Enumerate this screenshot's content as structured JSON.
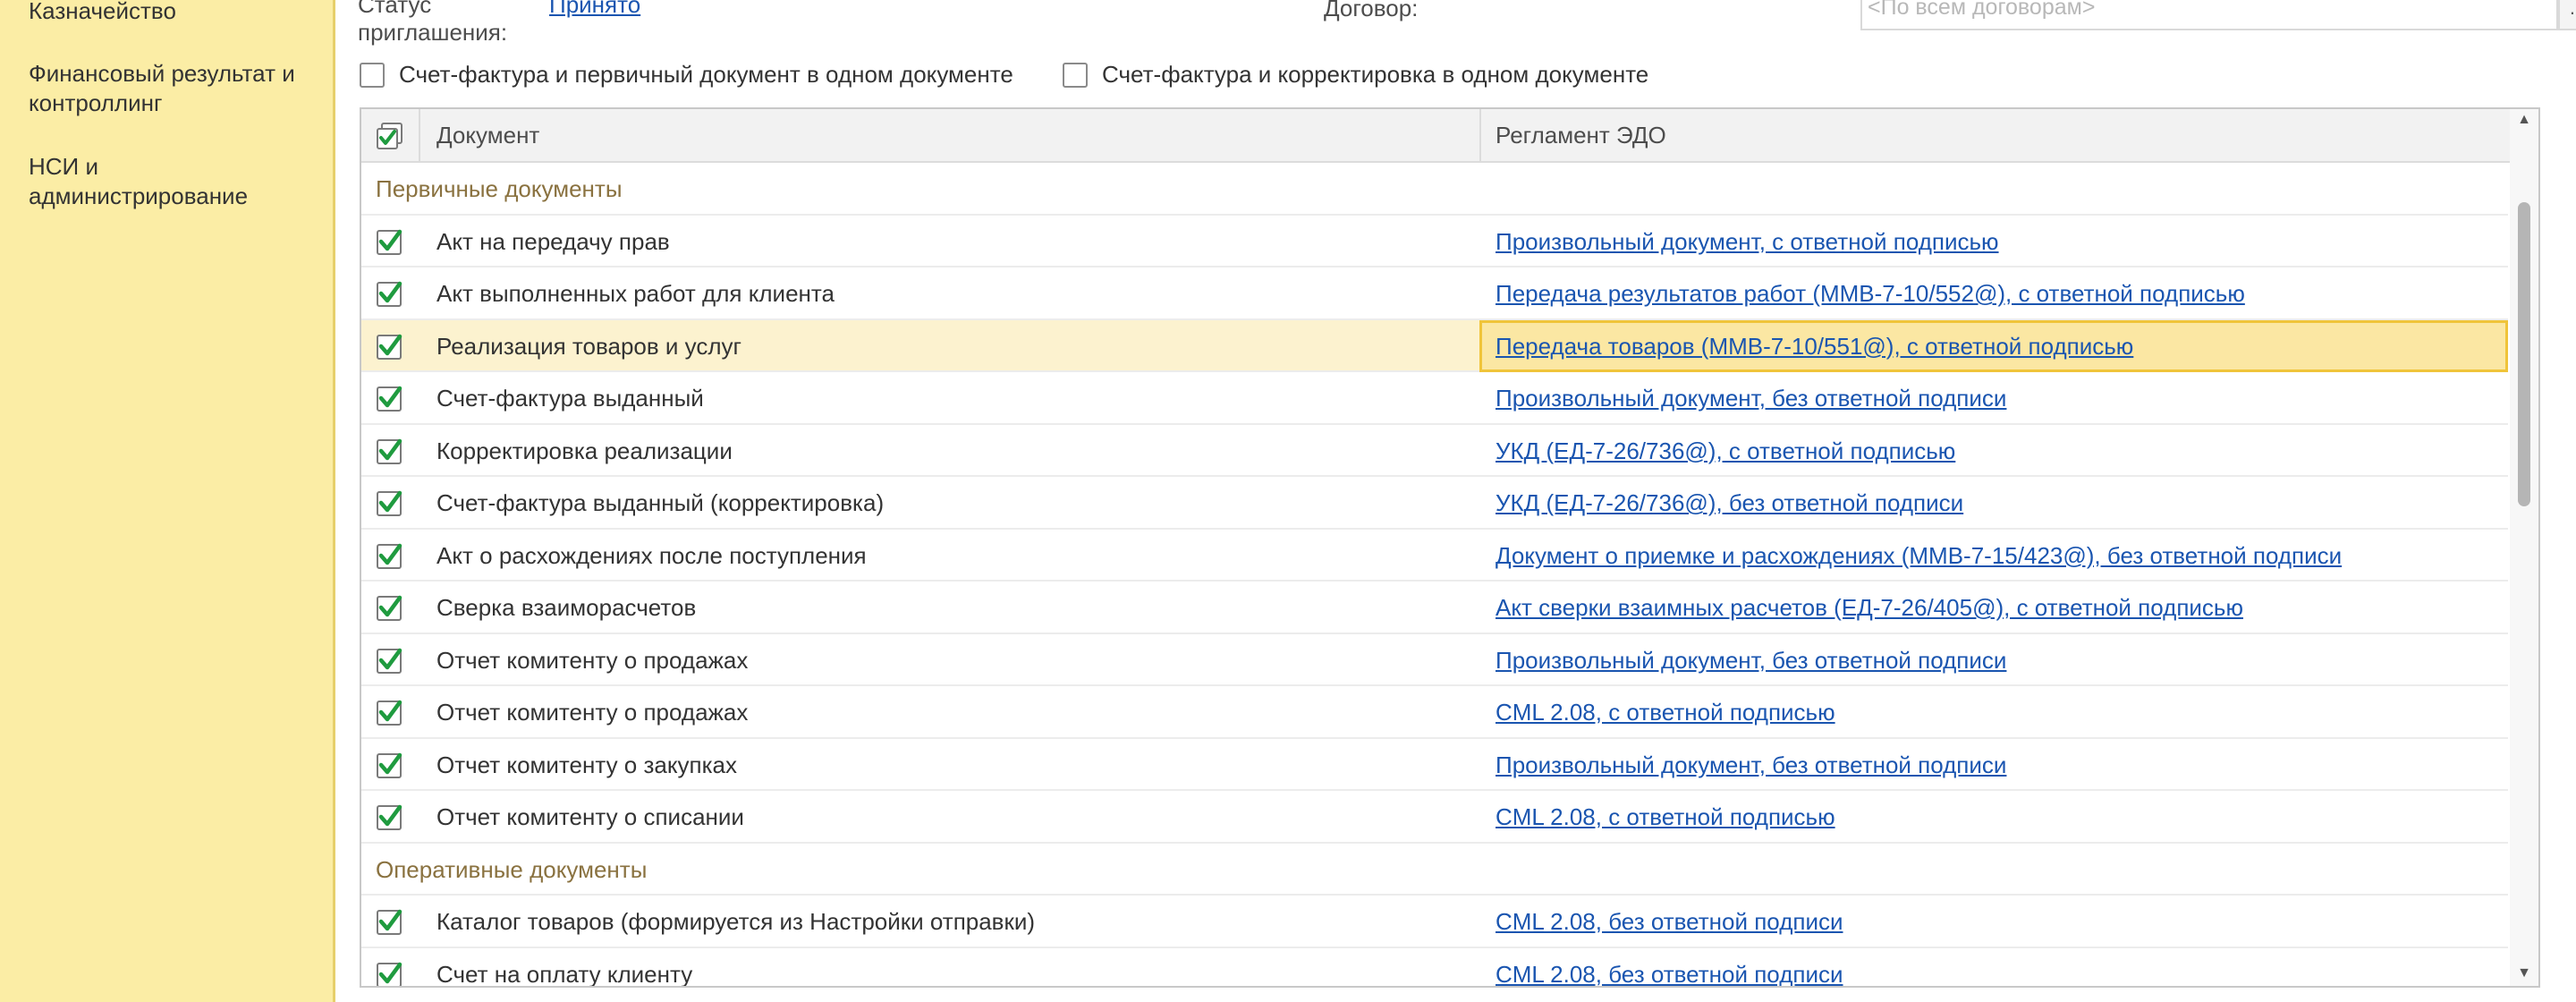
{
  "sidebar": {
    "items": [
      {
        "label": "Казначейство"
      },
      {
        "label": "Финансовый результат и контроллинг"
      },
      {
        "label": "НСИ и администрирование"
      }
    ]
  },
  "header": {
    "status_label": "Статус приглашения:",
    "status_value": "Принято",
    "contract_label": "Договор:",
    "contract_placeholder": "<По всем договорам>",
    "contract_button": "..."
  },
  "options": {
    "invoice_primary": "Счет-фактура и первичный документ в одном документе",
    "invoice_correction": "Счет-фактура и корректировка в одном документе"
  },
  "table": {
    "columns": {
      "document": "Документ",
      "regulation": "Регламент ЭДО"
    },
    "groups": [
      {
        "title": "Первичные документы",
        "rows": [
          {
            "document": "Акт на передачу прав",
            "regulation": "Произвольный документ, с ответной подписью"
          },
          {
            "document": "Акт выполненных работ для клиента",
            "regulation": "Передача результатов работ (ММВ-7-10/552@), с ответной подписью"
          },
          {
            "document": "Реализация товаров и услуг",
            "regulation": "Передача товаров (ММВ-7-10/551@), с ответной подписью"
          },
          {
            "document": "Счет-фактура выданный",
            "regulation": "Произвольный документ, без ответной подписи"
          },
          {
            "document": "Корректировка реализации",
            "regulation": "УКД (ЕД-7-26/736@), с ответной подписью"
          },
          {
            "document": "Счет-фактура выданный (корректировка)",
            "regulation": "УКД (ЕД-7-26/736@), без ответной подписи"
          },
          {
            "document": "Акт о расхождениях после поступления",
            "regulation": "Документ о приемке и расхождениях (ММВ-7-15/423@), без ответной подписи"
          },
          {
            "document": "Сверка взаиморасчетов",
            "regulation": "Акт сверки взаимных расчетов (ЕД-7-26/405@), с ответной подписью"
          },
          {
            "document": "Отчет комитенту о продажах",
            "regulation": "Произвольный документ, без ответной подписи"
          },
          {
            "document": "Отчет комитенту о продажах",
            "regulation": "CML 2.08, с ответной подписью"
          },
          {
            "document": "Отчет комитенту о закупках",
            "regulation": "Произвольный документ, без ответной подписи"
          },
          {
            "document": "Отчет комитенту о списании",
            "regulation": "CML 2.08, с ответной подписью"
          }
        ]
      },
      {
        "title": "Оперативные документы",
        "rows": [
          {
            "document": "Каталог товаров (формируется из Настройки отправки)",
            "regulation": "CML 2.08, без ответной подписи"
          },
          {
            "document": "Счет на оплату клиенту",
            "regulation": "CML 2.08, без ответной подписи"
          }
        ]
      }
    ]
  }
}
